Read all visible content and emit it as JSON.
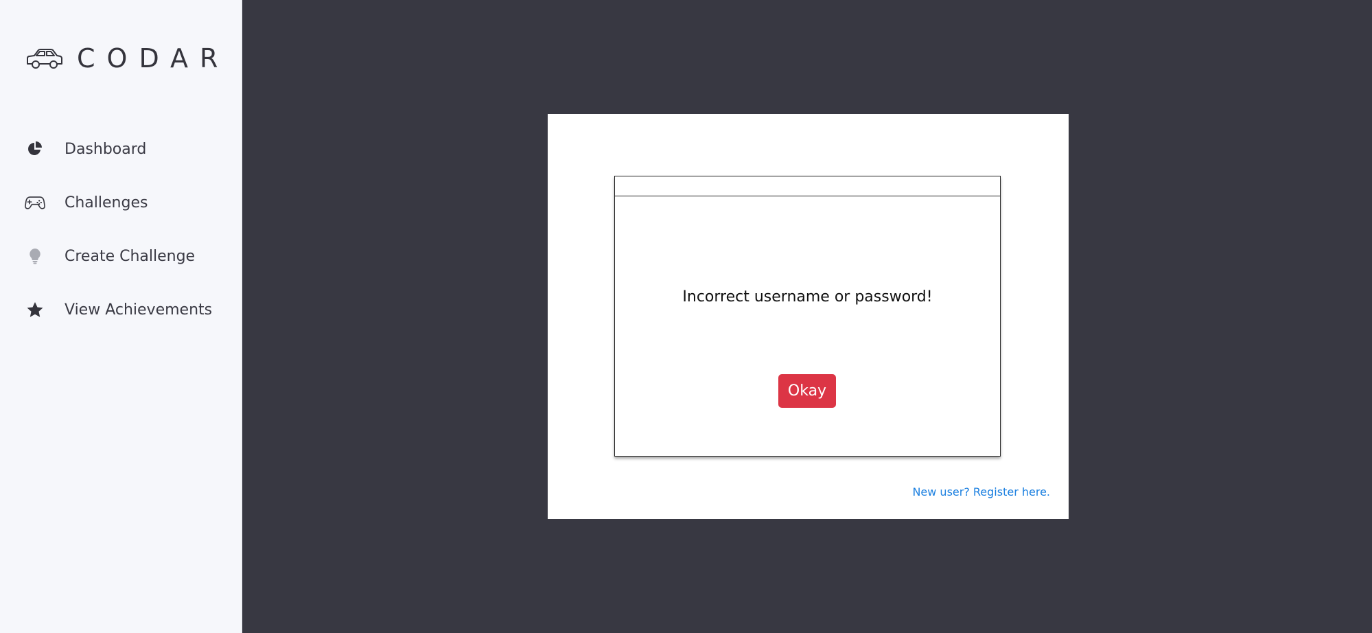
{
  "brand": {
    "name": "CODAR",
    "icon": "car-icon"
  },
  "sidebar": {
    "items": [
      {
        "label": "Dashboard",
        "icon": "pie-chart-icon"
      },
      {
        "label": "Challenges",
        "icon": "gamepad-icon"
      },
      {
        "label": "Create Challenge",
        "icon": "lightbulb-icon"
      },
      {
        "label": "View Achievements",
        "icon": "star-icon"
      }
    ]
  },
  "dialog": {
    "message": "Incorrect username or password!",
    "ok_label": "Okay"
  },
  "login": {
    "register_link": "New user? Register here."
  },
  "colors": {
    "background": "#383842",
    "sidebar": "#f6f7fb",
    "danger": "#dc3545",
    "link": "#1a7fe0"
  }
}
